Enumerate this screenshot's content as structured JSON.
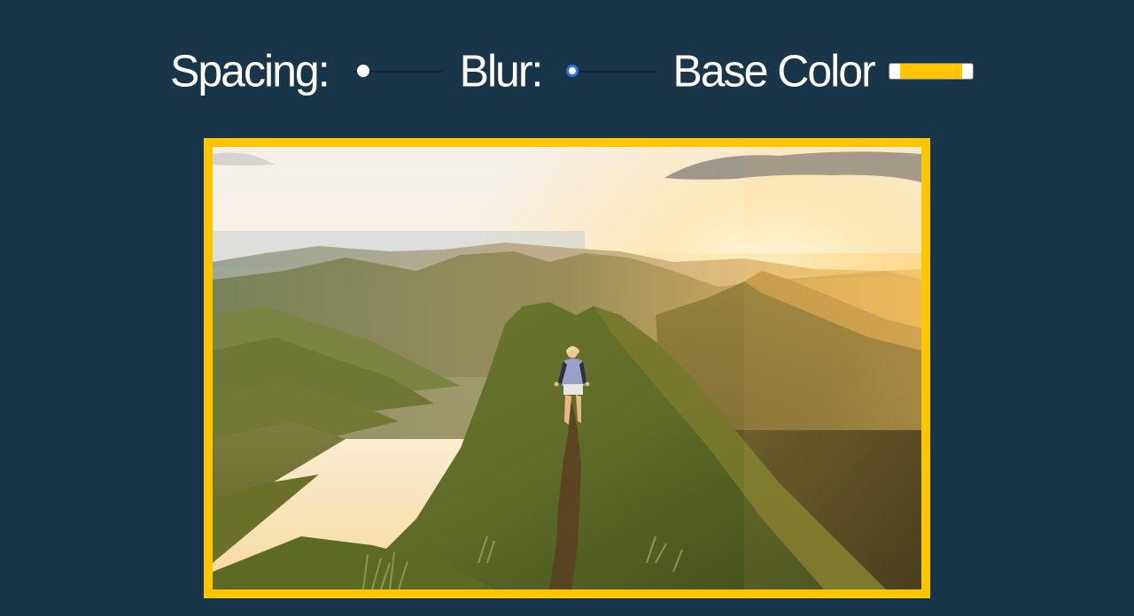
{
  "controls": {
    "spacing": {
      "label": "Spacing:",
      "value": 0.05
    },
    "blur": {
      "label": "Blur:",
      "value": 0.0
    },
    "base_color": {
      "label": "Base Color",
      "value": "#ffc600"
    }
  },
  "colors": {
    "background": "#193549",
    "accent": "#ffc600",
    "text": "#ffffff"
  },
  "image": {
    "subject": "hiker on mountain ridge trail at sunset"
  }
}
